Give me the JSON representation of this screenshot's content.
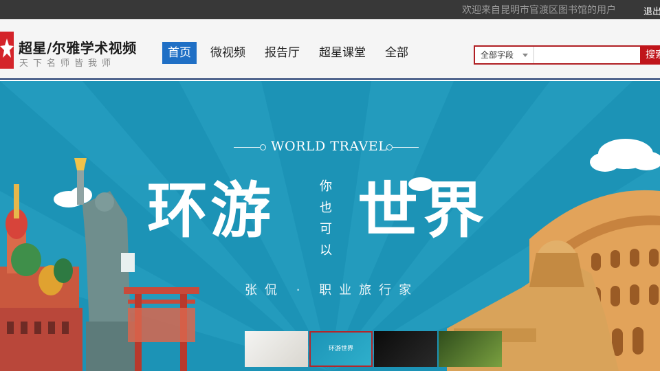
{
  "topbar": {
    "welcome": "欢迎来自昆明市官渡区图书馆的用户",
    "logout": "退出"
  },
  "header": {
    "logo_title": "超星/尔雅学术视频",
    "logo_subtitle": "天下名师皆我师",
    "nav": [
      {
        "label": "首页",
        "active": true
      },
      {
        "label": "微视频",
        "active": false
      },
      {
        "label": "报告厅",
        "active": false
      },
      {
        "label": "超星课堂",
        "active": false
      },
      {
        "label": "全部",
        "active": false
      }
    ],
    "search": {
      "field_select": "全部字段",
      "query": "",
      "button": "搜索"
    }
  },
  "banner": {
    "eyebrow": "WORLD TRAVEL",
    "title_left": "环游",
    "title_vertical": [
      "你",
      "也",
      "可",
      "以"
    ],
    "title_right": "世界",
    "author": "张侃 · 职业旅行家",
    "thumbnails": [
      {
        "caption": "",
        "active": false
      },
      {
        "caption": "环游世界",
        "active": true
      },
      {
        "caption": "",
        "active": false
      },
      {
        "caption": "",
        "active": false
      }
    ]
  },
  "colors": {
    "topbar_bg": "#383838",
    "nav_active": "#1f6fc5",
    "brand_red": "#c0151b",
    "banner_blue": "#1c93b6"
  }
}
